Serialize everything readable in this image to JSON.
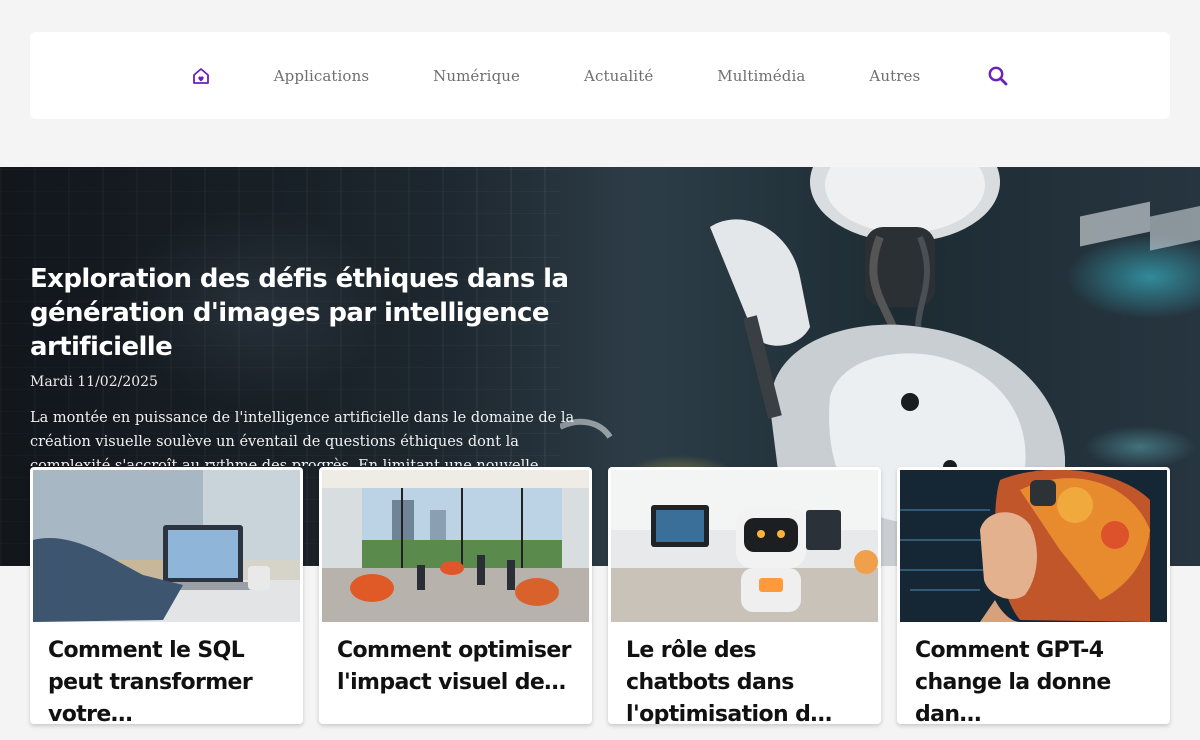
{
  "nav": {
    "home_icon": "home-icon",
    "items": [
      {
        "label": "Applications"
      },
      {
        "label": "Numérique"
      },
      {
        "label": "Actualité"
      },
      {
        "label": "Multimédia"
      },
      {
        "label": "Autres"
      }
    ],
    "search_icon": "search-icon",
    "accent_color": "#6a1fbf"
  },
  "hero": {
    "title": "Exploration des défis éthiques dans la génération d'images par intelligence artificielle",
    "date": "Mardi 11/02/2025",
    "excerpt": "La montée en puissance de l'intelligence artificielle dans le domaine de la création visuelle soulève un éventail de questions éthiques dont la complexité s'accroît au rythme des progrès. En limitant une nouvelle révolution de"
  },
  "cards": [
    {
      "title": "Comment le SQL peut transformer votre…"
    },
    {
      "title": "Comment optimiser l'impact visuel de…"
    },
    {
      "title": "Le rôle des chatbots dans l'optimisation d…"
    },
    {
      "title": "Comment GPT-4 change la donne dan…"
    }
  ]
}
